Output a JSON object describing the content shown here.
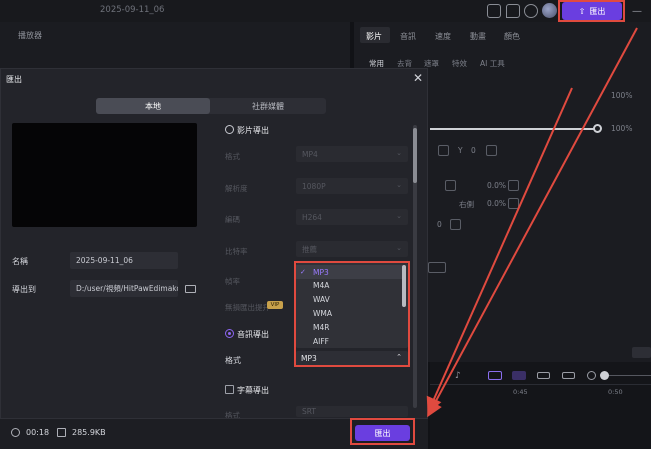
{
  "titlebar": {
    "project_name": "2025-09-11_06",
    "export_label": "匯出"
  },
  "left_panel": {
    "title": "播放器"
  },
  "right_panel": {
    "tabs": [
      "影片",
      "音訊",
      "速度",
      "動畫",
      "顏色"
    ],
    "subtabs": [
      "常用",
      "去背",
      "遮罩",
      "特效",
      "AI 工具"
    ],
    "values": {
      "percent1": "100%",
      "percent2": "100%",
      "y_label": "Y",
      "y_value": "0",
      "pct_a": "0.0%",
      "pct_b": "0.0%",
      "right_label": "右側",
      "rot_value": "0",
      "ruler_a": "0:45",
      "ruler_b": "0:50"
    }
  },
  "dialog": {
    "title": "匯出",
    "tabs": {
      "local": "本地",
      "social": "社群媒體"
    },
    "name_label": "名稱",
    "name_value": "2025-09-11_06",
    "export_to_label": "導出到",
    "export_path": "D:/user/視頻/HitPawEdimakor",
    "video_export": {
      "title": "影片導出",
      "format_label": "格式",
      "format_value": "MP4",
      "resolution_label": "解析度",
      "resolution_value": "1080P",
      "encoder_label": "編碼",
      "encoder_value": "H264",
      "bitrate_label": "比特率",
      "bitrate_value": "推薦",
      "fps_label": "幀率",
      "nolimit_label": "無損匯出提升",
      "vip": "VIP"
    },
    "audio_export": {
      "title": "音訊導出",
      "format_label": "格式",
      "format_value": "MP3",
      "options": [
        "MP3",
        "M4A",
        "WAV",
        "WMA",
        "M4R",
        "AIFF"
      ],
      "selected_index": 0
    },
    "subtitle_export": {
      "title": "字幕導出",
      "format_label": "格式",
      "format_value": "SRT"
    },
    "footer": {
      "duration": "00:18",
      "size": "285.9KB",
      "export_label": "匯出"
    }
  },
  "colors": {
    "accent": "#6a3ee0",
    "highlight": "#e04a3f",
    "selected_text": "#9a7bff"
  }
}
